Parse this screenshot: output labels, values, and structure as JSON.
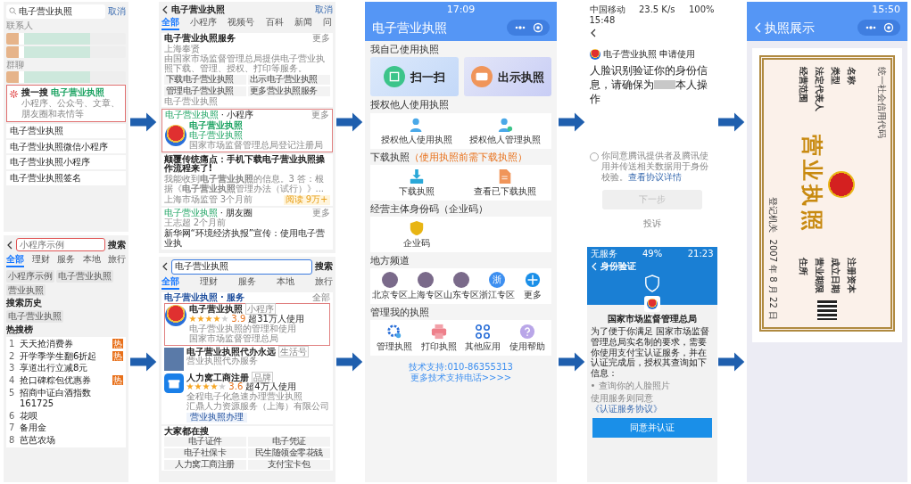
{
  "wechat_search": {
    "query": "电子营业执照",
    "cancel": "取消",
    "contacts_label": "联系人",
    "groups_label": "群聊",
    "souyisou": {
      "title": "搜一搜",
      "keyword": "电子营业执照",
      "subtitle": "小程序、公众号、文章、朋友圈和表情等"
    },
    "suggestions": [
      "电子营业执照",
      "电子营业执照微信小程序",
      "电子营业执照小程序",
      "电子营业执照签名"
    ]
  },
  "alipay_search": {
    "placeholder": "小程序示例",
    "search": "搜索",
    "tabs": [
      {
        "label": "全部",
        "selected": true
      },
      {
        "label": "理财",
        "selected": false
      },
      {
        "label": "服务",
        "selected": false
      },
      {
        "label": "本地",
        "selected": false
      },
      {
        "label": "旅行",
        "selected": false
      }
    ],
    "chips": [
      "小程序示例",
      "电子营业执照",
      "营业执照"
    ],
    "history_title": "搜索历史",
    "history": [
      "电子营业执照"
    ],
    "hot_title": "热搜榜",
    "hot": [
      {
        "rank": "1",
        "text": "天天抢消费券",
        "badge": "热"
      },
      {
        "rank": "2",
        "text": "开学季学生翻6折起",
        "badge": "热"
      },
      {
        "rank": "3",
        "text": "享道出行立减8元"
      },
      {
        "rank": "4",
        "text": "抢口碑粽包优惠券",
        "badge": "热"
      },
      {
        "rank": "5",
        "text": "招商中证白酒指数 161725"
      },
      {
        "rank": "6",
        "text": "花呗"
      },
      {
        "rank": "7",
        "text": "备用金"
      },
      {
        "rank": "8",
        "text": "芭芭农场"
      }
    ]
  },
  "wechat_results": {
    "query": "电子营业执照",
    "cancel": "取消",
    "tabs": [
      {
        "label": "全部",
        "selected": true
      },
      {
        "label": "小程序",
        "selected": false
      },
      {
        "label": "视频号",
        "selected": false
      },
      {
        "label": "百科",
        "selected": false
      },
      {
        "label": "新闻",
        "selected": false
      },
      {
        "label": "问",
        "selected": false
      }
    ],
    "service": {
      "title": "电子营业执照服务",
      "more": "更多",
      "location": "上海奉贤",
      "desc": "由国家市场监督管理总局提供电子营业执照下载、管理、授权、打印等服务。",
      "buttons": [
        "下载电子营业执照",
        "出示电子营业执照",
        "管理电子营业执照",
        "更多营业执照服务"
      ],
      "source": "电子营业执照"
    },
    "mini": {
      "heading": "电子营业执照",
      "heading_suffix": "· 小程序",
      "more": "更多",
      "name": "电子营业执照",
      "sub": "电子营业执照",
      "owner": "国家市场监督管理总局登记注册局"
    },
    "article": {
      "title": "颠覆传统痛点：手机下载**电子营业执照**操作流程来了!",
      "snippet": "我能收到**电子营业执照**的信息。3 答：根据《**电子营业执照**管理办法（试行）》...",
      "source": "上海市场监管",
      "time": "3个月前",
      "tag": "阅读 9万+"
    },
    "moments": {
      "heading": "电子营业执照",
      "heading_suffix": "· 朋友圈",
      "more": "更多",
      "user": "王志超",
      "time": "2个月前",
      "text": "新华网“环境经济执报”宣传：使用电子营业执"
    }
  },
  "alipay_results": {
    "query": "电子营业执照",
    "search": "搜索",
    "tabs": [
      {
        "label": "全部",
        "selected": true
      },
      {
        "label": "理财",
        "selected": false
      },
      {
        "label": "服务",
        "selected": false
      },
      {
        "label": "本地",
        "selected": false
      },
      {
        "label": "旅行",
        "selected": false
      }
    ],
    "section": "电子营业执照 · 服务",
    "all": "全部",
    "apps": [
      {
        "kind": "emblem",
        "name": "电子营业执照",
        "tag": "小程序",
        "stars": 4,
        "rating": "3.9",
        "users": "超31万人使用",
        "desc": "电子营业执照的管理和使用",
        "owner": "国家市场监督管理总局"
      },
      {
        "kind": "photo",
        "name": "电子营业执照代办永远",
        "tag": "生活号",
        "desc": "营业执照代办服务"
      },
      {
        "kind": "store",
        "name": "人力窝工商注册",
        "tag": "品牌",
        "stars": 4,
        "rating": "3.6",
        "users": "超4万人使用",
        "desc": "全程电子化急速办理营业执照",
        "owner": "汇鼎人力资源服务（上海）有限公司",
        "action": "营业执照办理"
      }
    ],
    "popular_title": "大家都在搜",
    "popular": [
      "电子证件",
      "电子凭证",
      "电子社保卡",
      "民生随领金零花钱",
      "人力窝工商注册",
      "支付宝卡包"
    ]
  },
  "mini_program": {
    "time": "17:09",
    "title": "电子营业执照",
    "sections": [
      {
        "title": "我自己使用执照",
        "kind": "big",
        "items": [
          {
            "label": "扫一扫",
            "kind": "qr"
          },
          {
            "label": "出示执照",
            "kind": "card"
          }
        ]
      },
      {
        "title": "授权他人使用执照",
        "kind": "grid",
        "items": [
          {
            "label": "授权他人使用执照",
            "kind": "user"
          },
          {
            "label": "授权他人管理执照",
            "kind": "usergear"
          }
        ]
      },
      {
        "title": "下载执照",
        "note": "（使用执照前需下载执照）",
        "kind": "grid",
        "items": [
          {
            "label": "下载执照",
            "kind": "download"
          },
          {
            "label": "查看已下载执照",
            "kind": "doc"
          }
        ]
      },
      {
        "title": "经营主体身份码（企业码）",
        "kind": "grid",
        "items": [
          {
            "label": "企业码",
            "kind": "shield"
          }
        ]
      },
      {
        "title": "地方频道",
        "kind": "row",
        "items": [
          {
            "label": "北京专区",
            "kind": "photo"
          },
          {
            "label": "上海专区",
            "kind": "photo"
          },
          {
            "label": "山东专区",
            "kind": "photo"
          },
          {
            "label": "浙江专区",
            "kind": "glyph",
            "glyph": "浙"
          },
          {
            "label": "更多",
            "kind": "more"
          }
        ]
      },
      {
        "title": "管理我的执照",
        "kind": "row",
        "items": [
          {
            "label": "管理执照",
            "kind": "gear"
          },
          {
            "label": "打印执照",
            "kind": "printer"
          },
          {
            "label": "其他应用",
            "kind": "apps"
          },
          {
            "label": "使用帮助",
            "kind": "help"
          }
        ]
      }
    ],
    "support": "技术支持:010-86355313",
    "support_link": "更多技术支持电话>>>>"
  },
  "face_check": {
    "carrier": "中国移动",
    "speed": "23.5 K/s",
    "battery": "100%",
    "time": "15:48",
    "app": "电子营业执照 申请使用",
    "heading": "人脸识别验证你的身份信息，请确保为",
    "heading_end": "本人操作",
    "agree_checked": false,
    "agreement": "你同意腾讯提供者及腾讯使用并传送相关数据用于身份校验。",
    "agreement_link": "查看协议详情",
    "next": {
      "label": "下一步",
      "disabled": true
    },
    "complain": "投诉"
  },
  "alipay_auth": {
    "carrier": "无服务",
    "battery": "49%",
    "time": "21:23",
    "title": "身份验证",
    "org": "国家市场监督管理总局",
    "desc": "为了便于你满足 国家市场监督管理总局实名制的要求，需要你使用支付宝认证服务，并在认证完成后，授权其查询如下信息：",
    "item": "• 查询你的人脸照片",
    "agree": "使用服务则同意",
    "agree_link": "《认证服务协议》",
    "button": "同意并认证"
  },
  "license_view": {
    "time": "15:50",
    "title": "执照展示",
    "license": {
      "code_label": "统一社会信用代码",
      "title": "营业执照",
      "left_fields": [
        "名称",
        "类型",
        "法定代表人",
        "经营范围"
      ],
      "right_fields": [
        "注册资本",
        "成立日期",
        "营业期限",
        "住所"
      ],
      "authority": "登记机关",
      "date": "2007 年 8 月 22 日"
    }
  }
}
